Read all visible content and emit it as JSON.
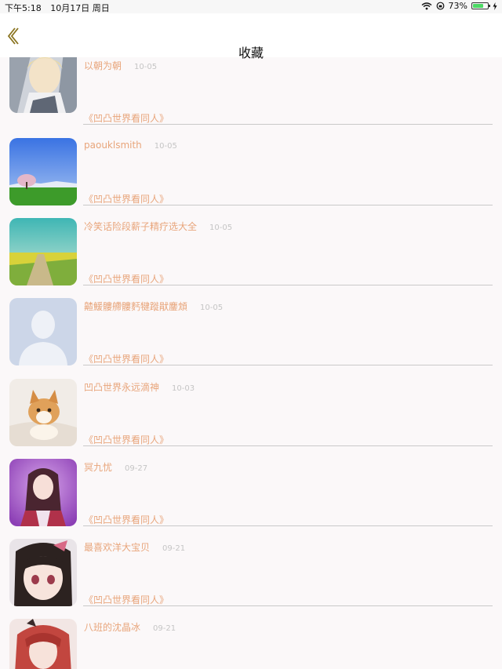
{
  "status_bar": {
    "time": "下午5:18",
    "date": "10月17日 周日",
    "battery": "73%",
    "battery_level": 0.73
  },
  "nav": {
    "title": "收藏",
    "back_icon": "chevron-left-icon",
    "accent_color": "#e8a57b"
  },
  "items": [
    {
      "name": "以朝为朝",
      "date": "10-05",
      "source": "《凹凸世界看同人》"
    },
    {
      "name": "paouklsmith",
      "date": "10-05",
      "source": "《凹凸世界看同人》"
    },
    {
      "name": "冷笑话险段薪子精疗选大全",
      "date": "10-05",
      "source": "《凹凸世界看同人》"
    },
    {
      "name": "齄鰀髏艜髏麫犍蹝猒鏖䪴",
      "date": "10-05",
      "source": "《凹凸世界看同人》"
    },
    {
      "name": "凹凸世界永远滴神",
      "date": "10-03",
      "source": "《凹凸世界看同人》"
    },
    {
      "name": "冥九忧",
      "date": "09-27",
      "source": "《凹凸世界看同人》"
    },
    {
      "name": "最喜欢洋大宝贝",
      "date": "09-21",
      "source": "《凹凸世界看同人》"
    },
    {
      "name": "八班的沈晶冰",
      "date": "09-21",
      "source": ""
    }
  ]
}
